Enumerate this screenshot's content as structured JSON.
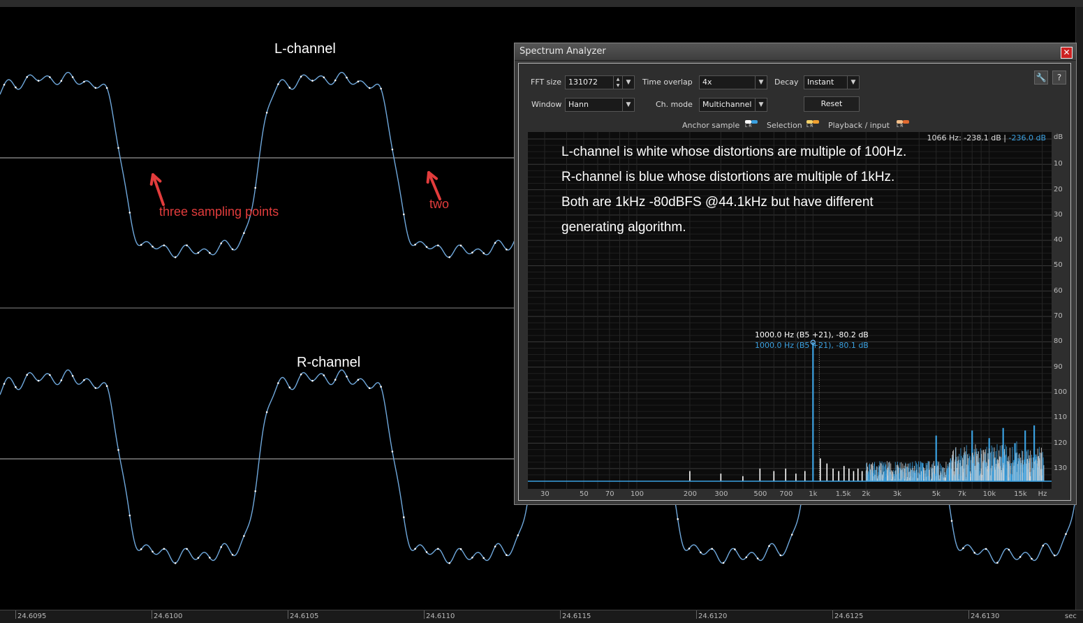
{
  "waveform": {
    "left_label": "L-channel",
    "right_label": "R-channel",
    "annotation_three": "three sampling points",
    "annotation_two": "two",
    "time_ticks": [
      "24.6095",
      "24.6100",
      "24.6105",
      "24.6110",
      "24.6115",
      "24.6120",
      "24.6125",
      "24.6130"
    ],
    "time_unit": "sec",
    "wave_color": "#6fa8dc",
    "annotation_color": "#e23c3c"
  },
  "spectrum_window": {
    "title": "Spectrum Analyzer",
    "close_label": "✕",
    "controls": {
      "fft_size_label": "FFT size",
      "fft_size_value": "131072",
      "time_overlap_label": "Time overlap",
      "time_overlap_value": "4x",
      "decay_label": "Decay",
      "decay_value": "Instant",
      "window_label": "Window",
      "window_value": "Hann",
      "ch_mode_label": "Ch. mode",
      "ch_mode_value": "Multichannel",
      "reset_label": "Reset",
      "settings_icon": "wrench-icon",
      "help_label": "?"
    },
    "legend": {
      "anchor_label": "Anchor sample",
      "selection_label": "Selection",
      "playback_label": "Playback / input",
      "lr_text": "L R"
    },
    "readout": {
      "freq": "1066 Hz:",
      "l_db": "-238.1 dB",
      "sep": "|",
      "r_db": "-236.0 dB",
      "unit": "dB"
    },
    "overlay_lines": [
      "L-channel is white whose distortions are multiple of 100Hz.",
      "R-channel is blue whose distortions are multiple of 1kHz.",
      "Both are 1kHz -80dBFS @44.1kHz but have different",
      "generating algorithm."
    ],
    "peak": {
      "l_text": "1000.0 Hz (B5 +21), -80.2 dB",
      "r_text": "1000.0 Hz (B5 +21), -80.1 dB"
    },
    "db_ticks": [
      "10",
      "20",
      "30",
      "40",
      "50",
      "60",
      "70",
      "80",
      "90",
      "100",
      "110",
      "120",
      "130"
    ],
    "freq_ticks": [
      "30",
      "50",
      "70",
      "100",
      "200",
      "300",
      "500",
      "700",
      "1k",
      "1.5k",
      "2k",
      "3k",
      "5k",
      "7k",
      "10k",
      "15k",
      "Hz"
    ],
    "colors": {
      "l_channel": "#ffffff",
      "r_channel": "#3aa0e0",
      "accent_orange": "#f0a030"
    }
  },
  "chart_data": {
    "type": "bar",
    "xlabel": "Hz",
    "ylabel": "dB",
    "x_scale": "log",
    "xlim": [
      25,
      21000
    ],
    "ylim": [
      -135,
      0
    ],
    "series": [
      {
        "name": "L-channel",
        "x": [
          200,
          300,
          400,
          500,
          600,
          700,
          800,
          900,
          1000,
          1100,
          1200,
          1300,
          1400,
          1500,
          1600,
          1700,
          1800,
          1900
        ],
        "values": [
          -131,
          -132,
          -133,
          -130,
          -131,
          -130,
          -132,
          -131,
          -80.2,
          -126,
          -128,
          -130,
          -131,
          -129,
          -130,
          -131,
          -130,
          -131
        ]
      },
      {
        "name": "R-channel",
        "x": [
          1000,
          5000,
          8000,
          10000,
          12000,
          14000,
          16000,
          18000
        ],
        "values": [
          -80.1,
          -117,
          -115,
          -118,
          -114,
          -120,
          -115,
          -113
        ]
      }
    ]
  }
}
